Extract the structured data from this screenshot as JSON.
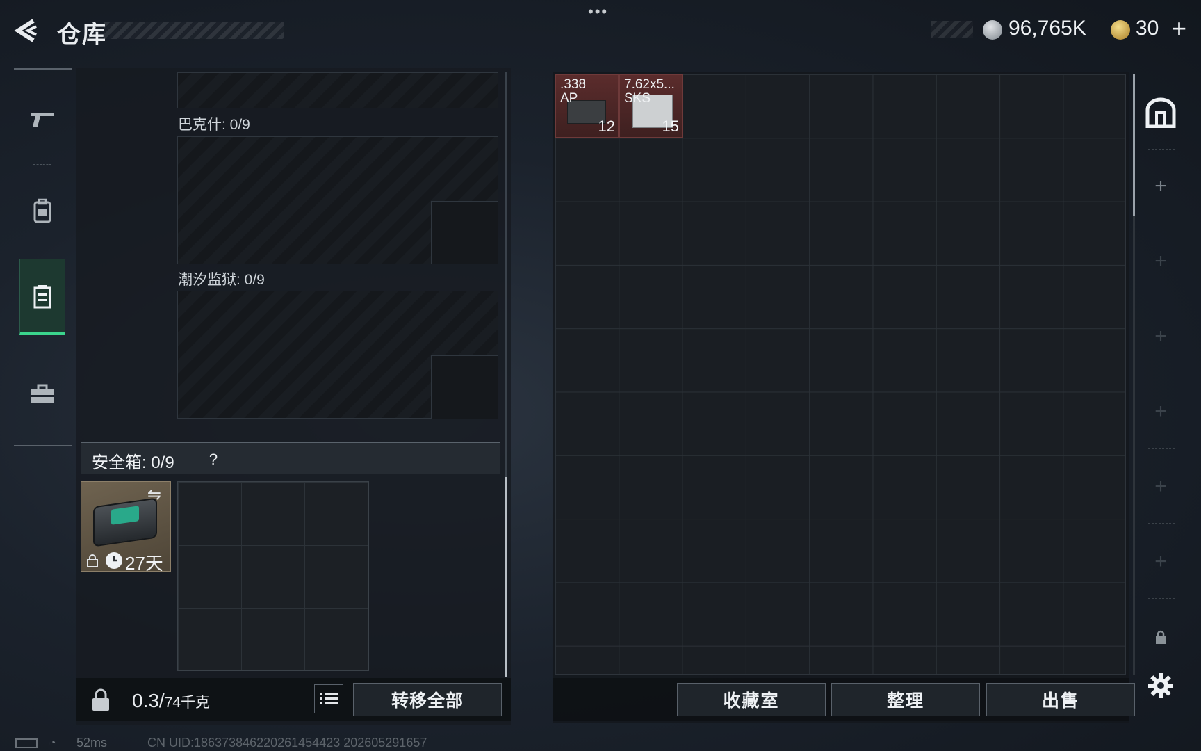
{
  "top_bar": {
    "menu_dots": "•••",
    "title": "仓库",
    "currency_silver": "96,765K",
    "currency_gold": "30",
    "add_currency": "+"
  },
  "left_rail": {
    "items": [
      "pistol-icon",
      "backpack-icon",
      "case-icon",
      "toolbox-icon"
    ],
    "active_index": 2
  },
  "containers": [
    {
      "label": "巴克什: 0/9"
    },
    {
      "label": "潮汐监狱: 0/9"
    }
  ],
  "safe_box": {
    "label": "安全箱: 0/9",
    "help": "?",
    "days_left": "27天"
  },
  "left_bottom": {
    "weight_value": "0.3/",
    "weight_limit": "74千克",
    "transfer_all": "转移全部"
  },
  "stash": {
    "items": [
      {
        "name": ".338\nAP",
        "count": "12"
      },
      {
        "name": "7.62x5...\nSKS",
        "count": "15"
      }
    ],
    "buttons": {
      "collection": "收藏室",
      "organize": "整理",
      "sell": "出售"
    }
  },
  "status_bar": {
    "ping": "52ms",
    "uid": "CN UID:1863738462202614544​23 202605291657"
  },
  "colors": {
    "accent_green": "#3bd58d",
    "ammo_red": "#5b2c2c",
    "panel": "#1a1e23"
  }
}
